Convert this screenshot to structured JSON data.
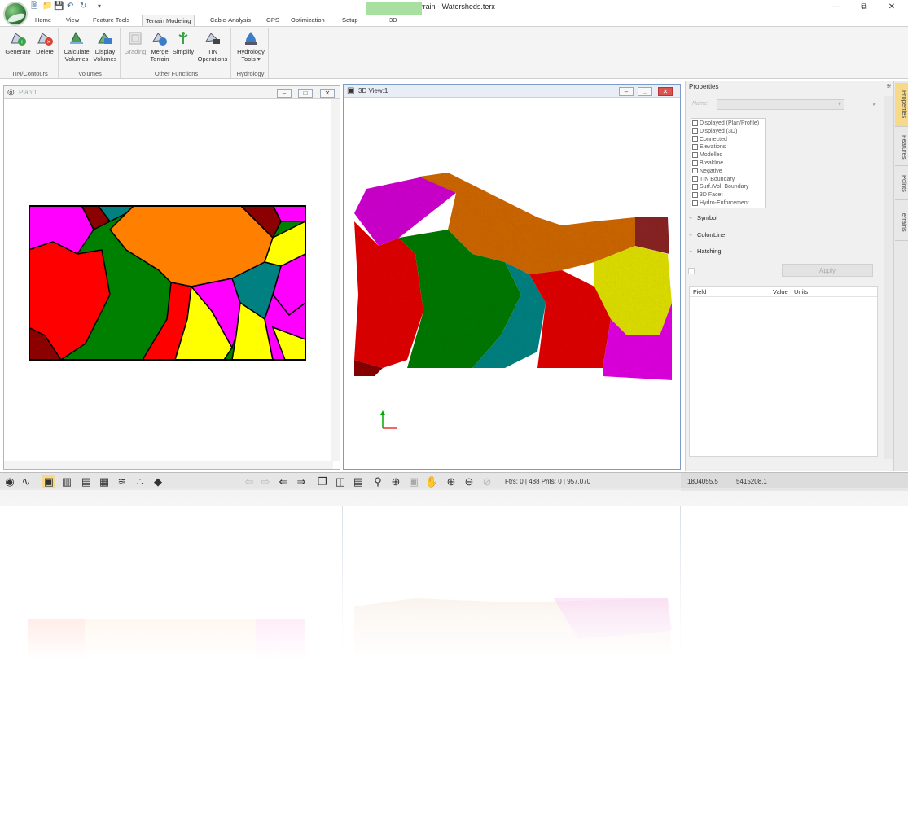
{
  "window": {
    "title": "Terrain - Watersheds.terx",
    "minimize": "—",
    "restore": "⧉",
    "close": "✕"
  },
  "ribbon_tabs": [
    "Home",
    "View",
    "Feature Tools",
    "Terrain Modeling",
    "Cable-Analysis",
    "GPS",
    "Optimization",
    "Setup",
    "3D"
  ],
  "active_tab": "Terrain Modeling",
  "ribbon_groups": [
    {
      "label": "TIN/Contours",
      "buttons": [
        "Generate",
        "Delete"
      ]
    },
    {
      "label": "Volumes",
      "buttons": [
        "Calculate Volumes",
        "Display Volumes"
      ]
    },
    {
      "label": "Other Functions",
      "buttons": [
        "Grading",
        "Merge Terrain",
        "Simplify",
        "TIN Operations"
      ]
    },
    {
      "label": "Hydrology",
      "buttons": [
        "Hydrology Tools"
      ]
    }
  ],
  "panes": {
    "plan_title": "Plan:1",
    "view3d_title": "3D View:1"
  },
  "properties": {
    "title": "Properties",
    "name_label": "Name:",
    "checkboxes": [
      "Displayed (Plan/Profile)",
      "Displayed (3D)",
      "Connected",
      "Elevations",
      "Modelled",
      "Breakline",
      "Negative",
      "TIN Boundary",
      "Surf./Vol. Boundary",
      "3D Facet",
      "Hydro-Enforcement"
    ],
    "sections": [
      "Symbol",
      "Color/Line",
      "Hatching"
    ],
    "apply_label": "Apply",
    "table_headers": [
      "Field",
      "Value",
      "Units"
    ]
  },
  "side_tabs": [
    "Properties",
    "Features",
    "Points",
    "Terrains"
  ],
  "status": {
    "counts": "Ftrs: 0 | 488   Pnts: 0 | 957.070",
    "x": "1804055.5",
    "y": "5415208.1"
  },
  "colors": {
    "red": "#ff0000",
    "green": "#008000",
    "orange": "#ff8000",
    "magenta": "#ff00ff",
    "yellow": "#ffff00",
    "teal": "#008080",
    "darkred": "#8b0000"
  }
}
